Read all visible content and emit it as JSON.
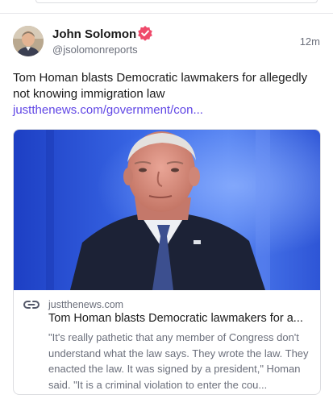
{
  "post": {
    "author": {
      "name": "John Solomon",
      "handle": "@jsolomonreports",
      "verified": true
    },
    "timestamp": "12m",
    "text": "Tom Homan blasts Democratic lawmakers for allegedly not knowing immigration law",
    "link_text": "justthenews.com/government/con...",
    "link_card": {
      "domain": "justthenews.com",
      "title": "Tom Homan blasts Democratic lawmakers for a...",
      "description": "\"It's really pathetic that any member of Congress don't understand what the law says. They wrote the law. They enacted the law. It was signed by a president,\" Homan said. \"It is a criminal violation to enter the cou..."
    }
  },
  "colors": {
    "link": "#6046e5",
    "verified_badge": "#ef4a6b",
    "muted_text": "#6b6f7b",
    "border": "#dcdde1"
  },
  "icons": {
    "verified": "verified-badge-icon",
    "link": "link-chain-icon"
  }
}
